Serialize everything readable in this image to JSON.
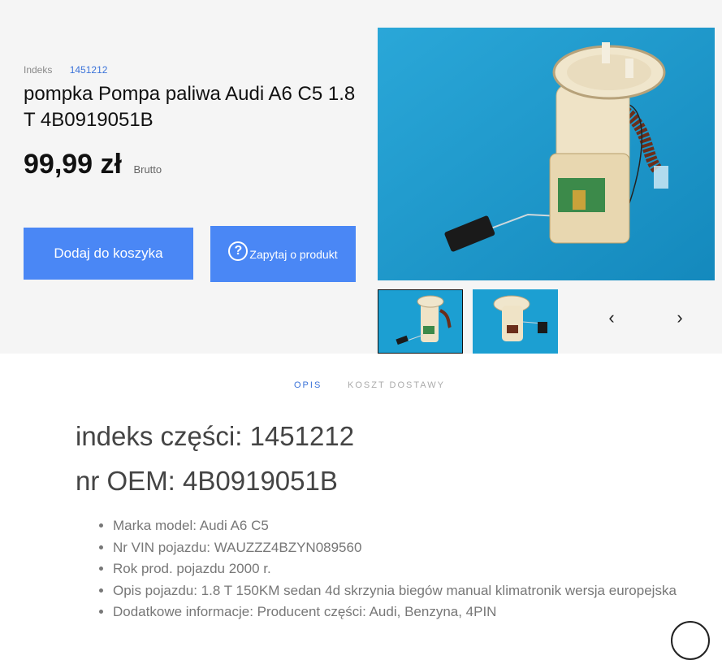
{
  "product": {
    "index_label": "Indeks",
    "index_value": "1451212",
    "title": "pompka Pompa paliwa Audi A6 C5 1.8 T 4B0919051B",
    "price": "99,99 zł",
    "price_suffix": "Brutto",
    "add_to_cart_label": "Dodaj do koszyka",
    "ask_label": "Zapytaj o produkt"
  },
  "gallery": {
    "prev_icon": "chevron-left-icon",
    "next_icon": "chevron-right-icon"
  },
  "tabs": [
    {
      "label": "OPIS",
      "active": true
    },
    {
      "label": "KOSZT DOSTAWY",
      "active": false
    }
  ],
  "description": {
    "part_index": "indeks części: 1451212",
    "oem": "nr OEM: 4B0919051B",
    "specs": [
      "Marka model: Audi A6 C5",
      "Nr VIN pojazdu: WAUZZZ4BZYN089560",
      "Rok prod. pojazdu 2000 r.",
      "Opis pojazdu: 1.8 T 150KM sedan 4d skrzynia biegów manual klimatronik wersja europejska",
      "Dodatkowe informacje: Producent części: Audi, Benzyna, 4PIN"
    ]
  },
  "colors": {
    "accent": "#4a87f5",
    "link": "#3b73d9",
    "photo_background": "#1c9fd2"
  }
}
